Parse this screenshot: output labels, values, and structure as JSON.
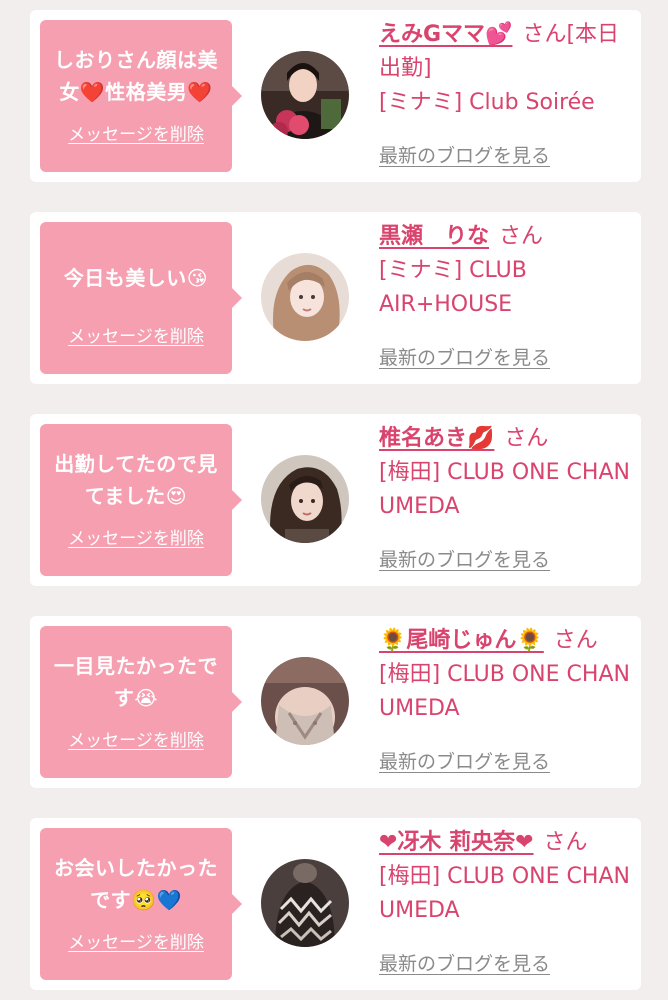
{
  "items": [
    {
      "message": "しおりさん顔は美女❤️性格美男❤️",
      "delete_label": "メッセージを削除",
      "name": "えみGママ💕",
      "honorific": "さん[本日出勤]",
      "shop": "[ミナミ] Club Soirée",
      "blog_label": "最新のブログを見る"
    },
    {
      "message": "今日も美しい😘",
      "delete_label": "メッセージを削除",
      "name": "黒瀬　りな",
      "honorific": "さん",
      "shop": "[ミナミ] CLUB AIR+HOUSE",
      "blog_label": "最新のブログを見る"
    },
    {
      "message": "出勤してたので見てました😍",
      "delete_label": "メッセージを削除",
      "name": "椎名あき💋",
      "honorific": "さん",
      "shop": "[梅田] CLUB ONE CHAN UMEDA",
      "blog_label": "最新のブログを見る"
    },
    {
      "message": "一目見たかったです😭",
      "delete_label": "メッセージを削除",
      "name": "🌻尾崎じゅん🌻",
      "honorific": "さん",
      "shop": "[梅田] CLUB ONE CHAN UMEDA",
      "blog_label": "最新のブログを見る"
    },
    {
      "message": "お会いしたかったです🥺💙",
      "delete_label": "メッセージを削除",
      "name": "❤︎冴木 莉央奈❤︎",
      "honorific": "さん",
      "shop": "[梅田] CLUB ONE CHAN UMEDA",
      "blog_label": "最新のブログを見る"
    }
  ],
  "colors": {
    "accent": "#d9446e",
    "bubble": "#f59fb1",
    "card_bg": "#ffffff",
    "page_bg": "#f3eeee",
    "muted_link": "#8a8a8a"
  }
}
